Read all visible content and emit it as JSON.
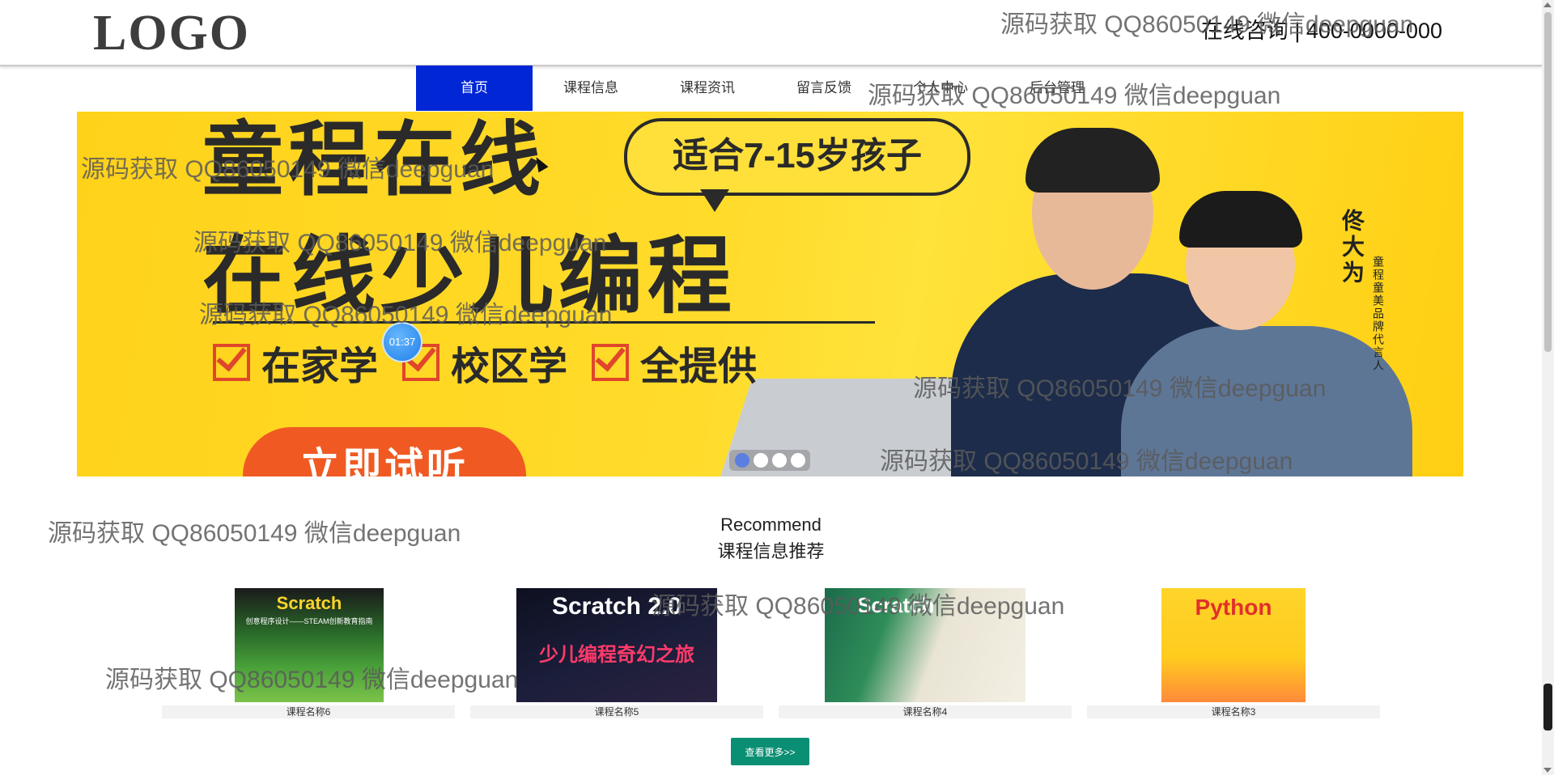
{
  "header": {
    "logo": "LOGO",
    "hotline": "在线咨询 | 400-0000-000"
  },
  "nav": {
    "items": [
      {
        "label": "首页",
        "active": true
      },
      {
        "label": "课程信息"
      },
      {
        "label": "课程资讯"
      },
      {
        "label": "留言反馈"
      },
      {
        "label": "个人中心"
      },
      {
        "label": "后台管理"
      }
    ]
  },
  "banner": {
    "title_line1": "童程在线",
    "title_line2": "在线少儿编程",
    "bubble": "适合7-15岁孩子",
    "features": [
      "在家学",
      "校区学",
      "全提供"
    ],
    "cta": "立即试听",
    "signature": "佟大为",
    "signature_note": "童程童美品牌代言人",
    "slide_count": 4,
    "active_slide": 1
  },
  "timer_badge": "01:37",
  "recommend": {
    "title_en": "Recommend",
    "title_cn": "课程信息推荐",
    "courses": [
      {
        "name": "课程名称6",
        "cover_text": "Scratch",
        "cover_sub": "创意程序设计——STEAM创新教育指南"
      },
      {
        "name": "课程名称5",
        "cover_text": "Scratch 2.0",
        "cover_sub": "少儿编程奇幻之旅"
      },
      {
        "name": "课程名称4",
        "cover_text": "Scratch",
        "cover_sub": ""
      },
      {
        "name": "课程名称3",
        "cover_text": "Python",
        "cover_sub": ""
      }
    ],
    "more_label": "查看更多>>"
  },
  "watermark": "源码获取 QQ86050149 微信deepguan",
  "colors": {
    "nav_active": "#0026d6",
    "banner_bg": "#ffd21a",
    "more_button": "#0b8f74"
  }
}
